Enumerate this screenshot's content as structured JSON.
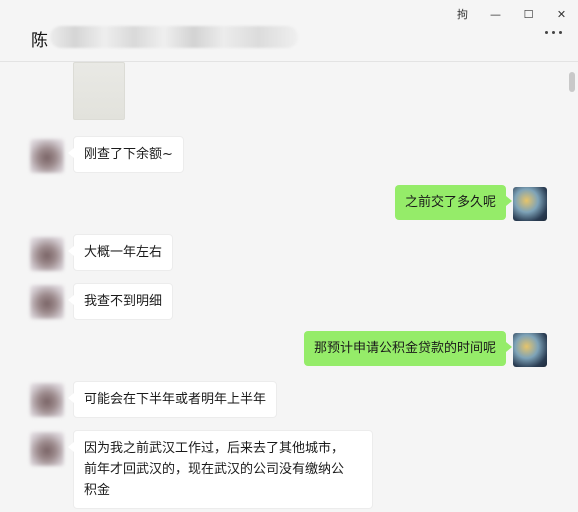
{
  "window": {
    "controls": {
      "pin": "拘",
      "minimize": "—",
      "maximize": "☐",
      "close": "✕"
    }
  },
  "header": {
    "title": "陈",
    "more_icon": "more-dots-icon"
  },
  "messages": [
    {
      "side": "left",
      "text": "刚查了下余额~"
    },
    {
      "side": "right",
      "text": "之前交了多久呢"
    },
    {
      "side": "left",
      "text": "大概一年左右"
    },
    {
      "side": "left",
      "text": "我查不到明细"
    },
    {
      "side": "right",
      "text": "那预计申请公积金贷款的时间呢"
    },
    {
      "side": "left",
      "text": "可能会在下半年或者明年上半年"
    },
    {
      "side": "left",
      "lines": [
        "因为我之前武汉工作过，后来去了其他城市，",
        "前年才回武汉的，现在武汉的公司没有缴纳公",
        "积金"
      ]
    }
  ],
  "colors": {
    "background": "#f5f5f5",
    "bubble_self": "#95ec69",
    "bubble_other": "#ffffff"
  }
}
